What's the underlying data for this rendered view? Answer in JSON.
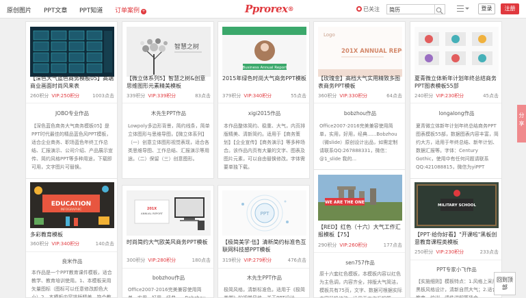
{
  "nav": {
    "items": [
      "原创图片",
      "PPT文章",
      "PPT知道"
    ],
    "active": "订单案例",
    "active_badge": "+"
  },
  "logo": {
    "text": "Pprorex",
    "reg": "®"
  },
  "header": {
    "weibo_label": "已关注",
    "search_value": "简历",
    "login_label": "登录",
    "register_label": "注册"
  },
  "cards": [
    {
      "title": "【深色大气蓝色商务模板05】高端商业画面时尚风来表",
      "price": "260积分",
      "vip": "VIP:250积分",
      "count": "1003点击",
      "author": "JOBO专业作品",
      "desc": "【深色蓝色商务大气商务模板05】是PPT时代最佳的精品蓝色风PPT模板，适合企业商务、职场蓝色年终工作总结、汇报演示、公司介绍、产品展示宣传、简约风格PPT等多种用途，下载即可用，文字图片可替换。"
    },
    {
      "title": "【微立体系列5】智慧之树&创意思维图形元素精美模板",
      "price": "339积分",
      "vip": "VIP:339积分",
      "count": "83点击",
      "author": "木先生PPT作品",
      "desc": "Lowpoly多边形背景，简约线条，简单立体图形与思维导图，【微立体系列】（一）创意立体图形视觉表现，适合各类思维导图、工作总结、汇报演示等用途。（二）保留（三）创意图形。"
    },
    {
      "title": "2015年绿色时尚大气商务PPT模板",
      "price": "379积分",
      "vip": "VIP:340积分",
      "count": "55点击",
      "author": "xigi2015作品",
      "desc": "本作品整体简约、稳重、大气，内页排版精美、清新简约。适用于【商务策划】【企业宣传】【商务演示】等多种场合。该作品内页有大量的文字、图表及图片元素，可以自由替换修改。字体需要单独下载。"
    },
    {
      "title": "【玫瑰金】高档大气实用精致多图表商务PPT模板",
      "price": "360积分",
      "vip": "VIP:330积分",
      "count": "64点击",
      "author": "bobzhou作品",
      "desc": "Office2007-2016完美兼容使用简单，实用，好用，经典......Bobzhou（微slide）原创设计出品，如需定制请联系QQ:267888331，微信：@1_slide 我的..."
    },
    {
      "title": "夏青微立体新年计划年终总结商务PPT图表模板55部",
      "price": "240积分",
      "vip": "VIP:230积分",
      "count": "45点击",
      "author": "longalong作品",
      "desc": "夏青微立体新年计划年终总结商务PPT图表模板55部，数据图表内容丰富，简约大方，适用于年终总结、新年计划、数据汇报等。字体：Century Gothic，使用中有任何问题请联系QQ:421088815，微信为yiPPT"
    },
    {
      "title": "多彩教育模板",
      "price": "360积分",
      "vip": "VIP:340积分",
      "count": "140点击",
      "author": "良米作品",
      "desc": "本作品是一个PPT教育课件模板，适合教学、教育培训使用。1、本模板采用矢量图标（图标可以任意修改颜色大小）2、本模板内容排版精美，符合教育行业风格。"
    },
    {
      "title": "时尚简约大气欧美风商务PPT模板",
      "price": "300积分",
      "vip": "VIP:280积分",
      "count": "180点击",
      "author": "bobzhou作品",
      "desc": "Office2007-2016完美兼容使用简单，实用，好用，经典......Bobzhou（微slide）原创设计出品"
    },
    {
      "title": "【极简美学·伍】清新简约标准色互联网科技感PPT模板",
      "price": "319积分",
      "vip": "VIP:279积分",
      "count": "476点击",
      "author": "木先生PPT作品",
      "desc": "极简风格，清新标准色，适用于《极简美学》的视觉风格，关于PPT设计..."
    },
    {
      "title": "【RED】红色（十六）大气工作汇报模板【75】",
      "price": "290积分",
      "vip": "VIP:260积分",
      "count": "177点击",
      "author": "sen757作品",
      "desc": "原十六套红色模板，本模板内容以红色为主色调，内容齐全，排版大气简洁，模板共有75页，文字、数据可根据实际内容替换修改，适用于工作汇报等。"
    },
    {
      "title": "【PPT·给你好看】\"开课啦\"黑板创意教育课程类模板",
      "price": "250积分",
      "vip": "VIP:230积分",
      "count": "233点击",
      "author": "PPT专家小飞作品",
      "desc": "【实施细则】模板特点：1.风格上采用黑板风格设计，清新自然大气；2.适合教育、培训、课件讲解等场合。"
    }
  ],
  "share_label": "分享",
  "backtop_label": "回到顶部"
}
